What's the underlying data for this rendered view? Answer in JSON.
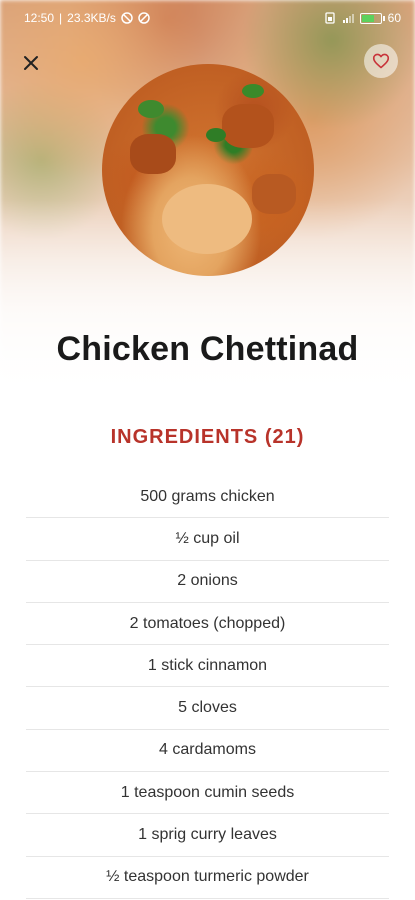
{
  "status_bar": {
    "time": "12:50",
    "network_speed": "23.3KB/s",
    "battery": "60"
  },
  "recipe": {
    "title": "Chicken Chettinad",
    "ingredients_heading": "INGREDIENTS (21)",
    "ingredients": [
      "500 grams chicken",
      "½ cup oil",
      "2 onions",
      "2 tomatoes (chopped)",
      "1 stick cinnamon",
      "5 cloves",
      "4 cardamoms",
      "1 teaspoon cumin seeds",
      "1 sprig curry leaves",
      "½ teaspoon turmeric powder"
    ]
  },
  "icons": {
    "close": "close-icon",
    "favorite": "heart-outline-icon"
  },
  "colors": {
    "accent": "#b8332a",
    "text": "#1a1a1a"
  }
}
